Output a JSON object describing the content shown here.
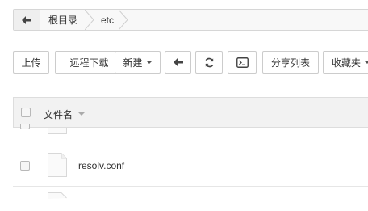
{
  "breadcrumb": {
    "back_icon": "arrow-left-icon",
    "items": [
      "根目录",
      "etc"
    ]
  },
  "toolbar": {
    "upload": "上传",
    "remote_download": "远程下载",
    "new": "新建",
    "back_icon": "arrow-left-icon",
    "refresh_icon": "refresh-icon",
    "terminal_icon": "terminal-icon",
    "share_list": "分享列表",
    "favorites": "收藏夹"
  },
  "table": {
    "header": {
      "name_column": "文件名"
    },
    "rows": [
      {
        "name": "",
        "icon": "file-icon"
      },
      {
        "name": "resolv.conf",
        "icon": "file-icon"
      },
      {
        "name": "",
        "icon": "file-icon"
      }
    ]
  },
  "colors": {
    "border": "#cccccc",
    "header_bg": "#f2f2f2",
    "crumb_bg": "#f8f8f8"
  }
}
